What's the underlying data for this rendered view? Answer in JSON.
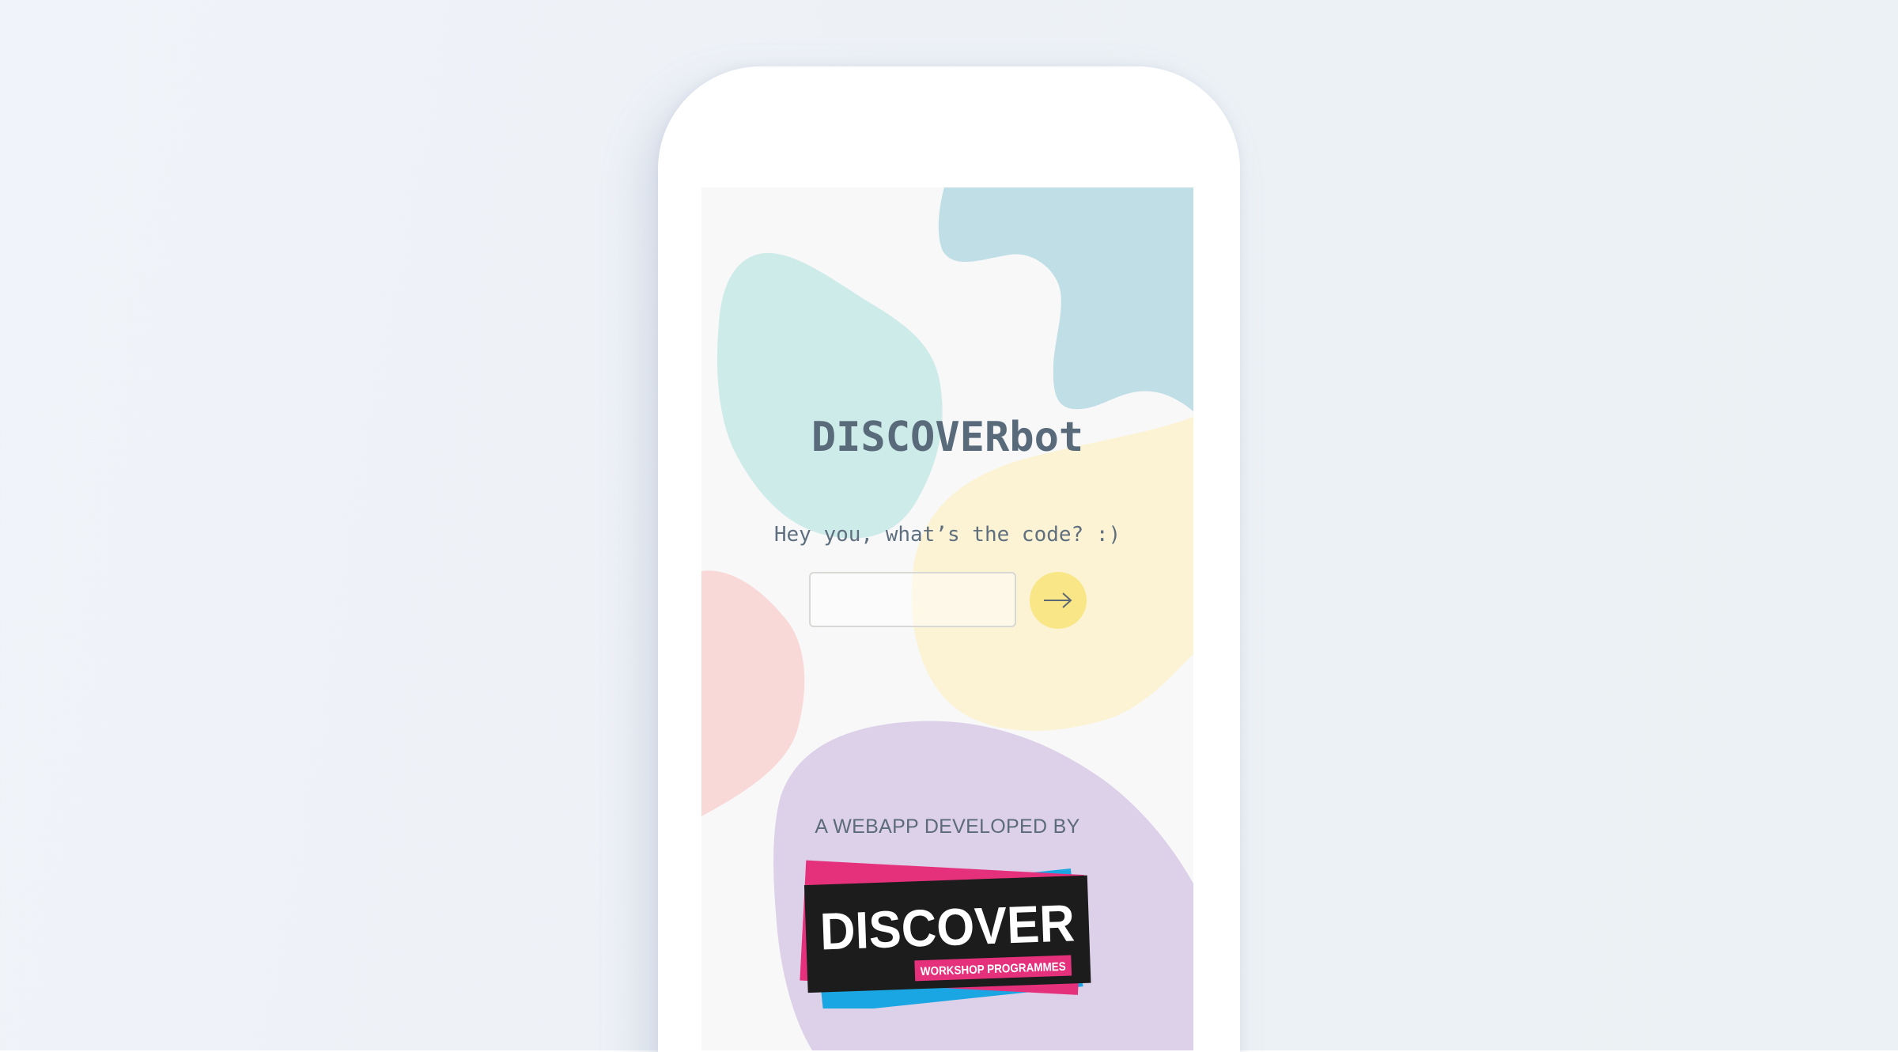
{
  "app": {
    "title": "DISCOVERbot",
    "prompt": "Hey you, what’s the code? :)"
  },
  "form": {
    "code_value": "",
    "code_placeholder": "",
    "submit_icon": "arrow-right-icon"
  },
  "footer": {
    "credit": "A WEBAPP DEVELOPED BY",
    "logo_main": "DISCOVER",
    "logo_sub": "WORKSHOP PROGRAMMES"
  },
  "colors": {
    "text": "#596a7a",
    "button": "#f9e787",
    "blob_mint": "#cdebe8",
    "blob_blue": "#bfdee6",
    "blob_yellow": "#fbf3d3",
    "blob_pink": "#f9d8d8",
    "blob_purple": "#ddd0e9",
    "logo_black": "#1c1c1c",
    "logo_pink": "#e5317b",
    "logo_blue": "#1aa6e2"
  }
}
